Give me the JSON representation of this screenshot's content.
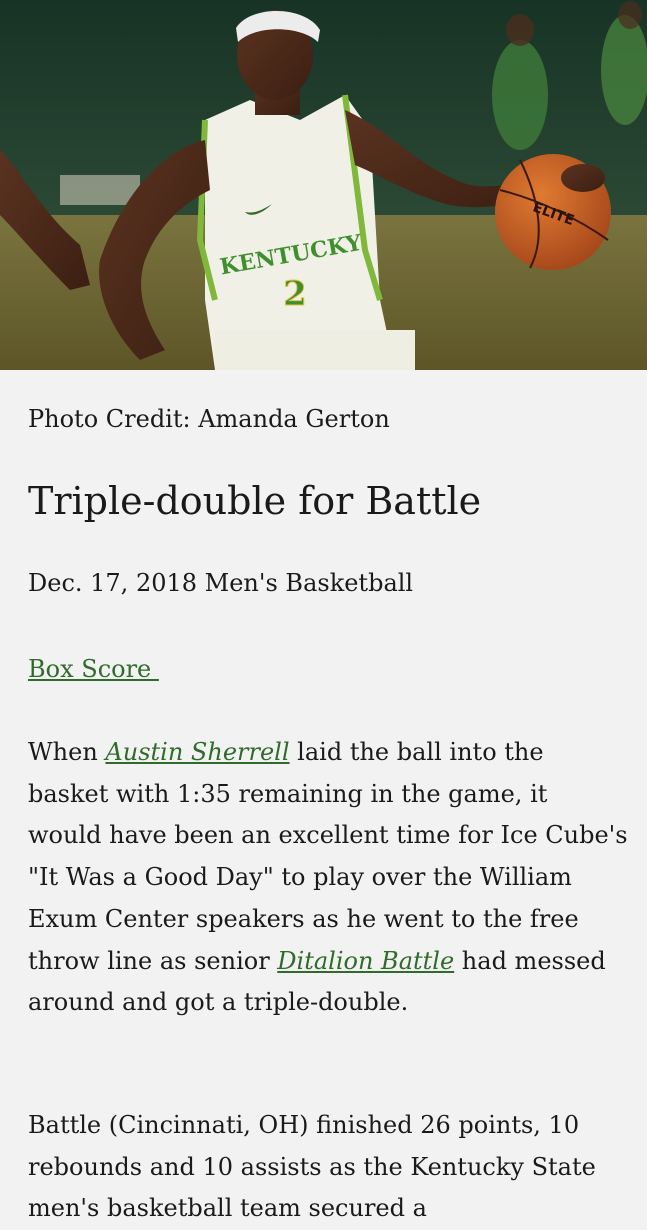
{
  "article": {
    "photo_credit": "Photo Credit: Amanda Gerton",
    "title": "Triple-double for Battle",
    "meta": "Dec. 17, 2018 Men's Basketball",
    "box_score_label": "Box Score ",
    "paragraph1": {
      "part1": "When ",
      "link1": "Austin Sherrell",
      "part2": " laid the ball into the basket with 1:35 remaining in the game, it would have been an excellent time for Ice Cube's \"It Was a Good Day\" to play over the William Exum Center speakers as he went to the free throw line as senior ",
      "link2": "Ditalion Battle",
      "part3": " had messed around and got a triple-double."
    },
    "paragraph2": "Battle (Cincinnati, OH) finished 26 points, 10 rebounds and 10 assists as the Kentucky State men's basketball team secured a",
    "hero_image": {
      "jersey_text": "KENTUCKY",
      "jersey_number": "2",
      "ball_text": "ELITE"
    }
  },
  "colors": {
    "background": "#f2f2f2",
    "link": "#2f6b2a",
    "text": "#1a1a1a",
    "jersey_trim": "#7fb83a",
    "jersey_lettering": "#3f8f2f"
  }
}
